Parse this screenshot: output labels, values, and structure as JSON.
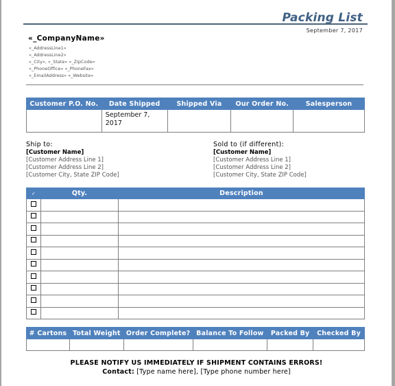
{
  "document": {
    "title": "Packing List",
    "date": "September 7, 2017",
    "company": {
      "name": "«_CompanyName»",
      "address_line1": "«_AddressLine1»",
      "address_line2": "«_AddressLine2»",
      "city_state_zip": "«_City», «_State»  «_ZipCode»",
      "phones": "«_PhoneOffice»   «_PhoneFax»",
      "email_web": "«_EmailAddress»   «_Website»"
    },
    "order_table": {
      "headers": [
        "Customer P.O. No.",
        "Date Shipped",
        "Shipped Via",
        "Our Order No.",
        "Salesperson"
      ],
      "row": [
        "",
        "September 7, 2017",
        "",
        "",
        ""
      ]
    },
    "ship_to": {
      "label": "Ship to:",
      "name": "[Customer  Name]",
      "line1": "[Customer Address  Line 1]",
      "line2": "[Customer Address  Line 2]",
      "city": "[Customer City, State ZIP Code]"
    },
    "sold_to": {
      "label": "Sold to (if different):",
      "name": "[Customer  Name]",
      "line1": "[Customer Address  Line 1]",
      "line2": "[Customer Address  Line 2]",
      "city": "[Customer City, State ZIP Code]"
    },
    "items_table": {
      "headers": [
        "✓",
        "Qty.",
        "Description"
      ],
      "row_count": 10,
      "rows": [
        {
          "checked": false,
          "qty": "",
          "description": ""
        },
        {
          "checked": false,
          "qty": "",
          "description": ""
        },
        {
          "checked": false,
          "qty": "",
          "description": ""
        },
        {
          "checked": false,
          "qty": "",
          "description": ""
        },
        {
          "checked": false,
          "qty": "",
          "description": ""
        },
        {
          "checked": false,
          "qty": "",
          "description": ""
        },
        {
          "checked": false,
          "qty": "",
          "description": ""
        },
        {
          "checked": false,
          "qty": "",
          "description": ""
        },
        {
          "checked": false,
          "qty": "",
          "description": ""
        },
        {
          "checked": false,
          "qty": "",
          "description": ""
        }
      ]
    },
    "summary_table": {
      "headers": [
        "# Cartons",
        "Total Weight",
        "Order Complete?",
        "Balance To Follow",
        "Packed By",
        "Checked By"
      ],
      "row": [
        "",
        "",
        "",
        "",
        "",
        ""
      ]
    },
    "notice": "PLEASE NOTIFY US IMMEDIATELY IF SHIPMENT CONTAINS ERRORS!",
    "contact_label": "Contact:",
    "contact_value": " [Type name here], [Type phone number here]"
  },
  "colors": {
    "header_fill": "#4f81bd",
    "title": "#3f6184",
    "border": "#7f7f7f"
  }
}
